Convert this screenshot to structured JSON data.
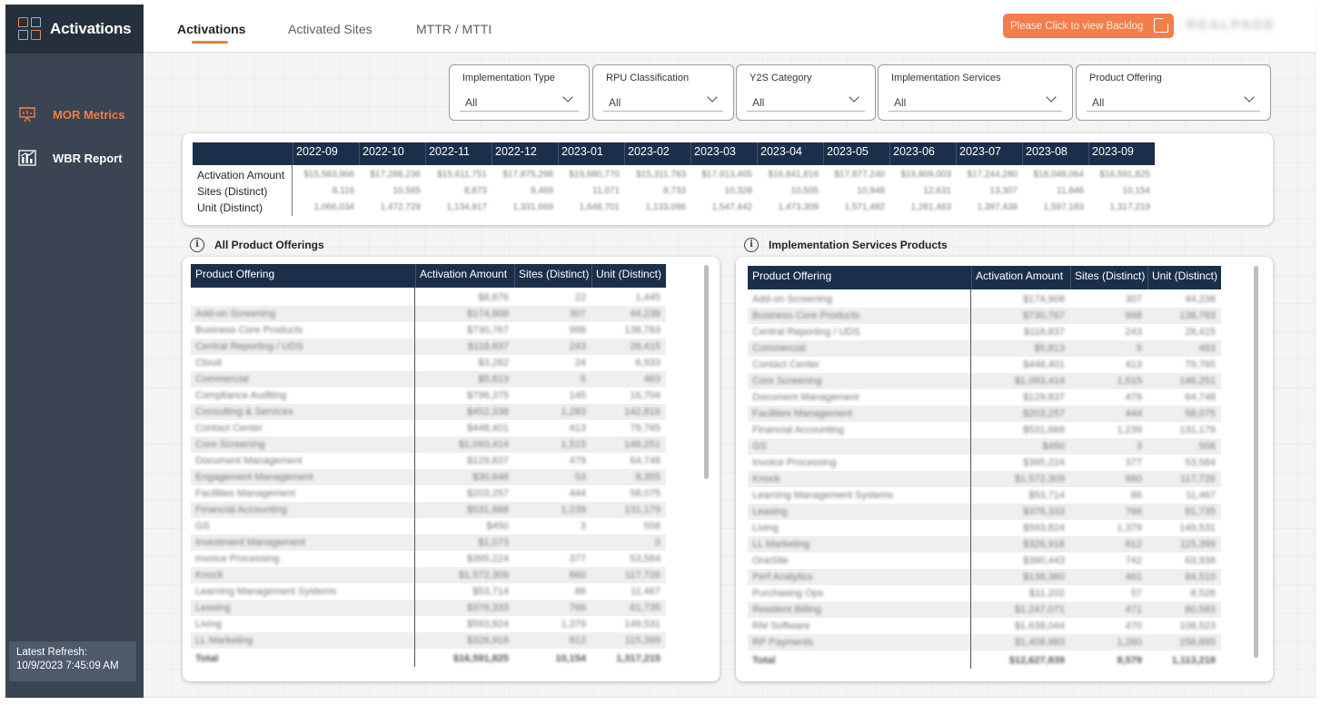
{
  "app": {
    "title": "Activations"
  },
  "sidebar": {
    "items": [
      {
        "label": "MOR Metrics",
        "icon": "presentation-chart-icon",
        "active": true
      },
      {
        "label": "WBR Report",
        "icon": "bar-chart-icon",
        "active": false
      }
    ],
    "refresh": {
      "label": "Latest Refresh:",
      "value": "10/9/2023 7:45:09 AM"
    }
  },
  "tabs": [
    {
      "label": "Activations",
      "active": true
    },
    {
      "label": "Activated Sites",
      "active": false
    },
    {
      "label": "MTTR / MTTI",
      "active": false
    }
  ],
  "header": {
    "backlog_button": "Please Click to view Backlog",
    "logo_text": "REALPAGE"
  },
  "filters": [
    {
      "label": "Implementation Type",
      "value": "All"
    },
    {
      "label": "RPU Classification",
      "value": "All"
    },
    {
      "label": "Y2S Category",
      "value": "All"
    },
    {
      "label": "Implementation Services",
      "value": "All"
    },
    {
      "label": "Product Offering",
      "value": "All"
    }
  ],
  "monthly": {
    "months": [
      "2022-09",
      "2022-10",
      "2022-11",
      "2022-12",
      "2023-01",
      "2023-02",
      "2023-03",
      "2023-04",
      "2023-05",
      "2023-06",
      "2023-07",
      "2023-08",
      "2023-09"
    ],
    "rows": [
      {
        "label": "Activation Amount",
        "values": [
          "$15,583,966",
          "$17,288,236",
          "$15,611,751",
          "$17,875,298",
          "$19,680,770",
          "$15,311,783",
          "$17,913,405",
          "$16,841,816",
          "$17,877,240",
          "$19,809,003",
          "$17,244,280",
          "$18,048,064",
          "$16,591,825"
        ]
      },
      {
        "label": "Sites (Distinct)",
        "values": [
          "8,116",
          "10,565",
          "8,873",
          "9,469",
          "11,071",
          "8,733",
          "10,328",
          "10,505",
          "10,948",
          "12,631",
          "13,307",
          "11,846",
          "10,154"
        ]
      },
      {
        "label": "Unit (Distinct)",
        "values": [
          "1,066,034",
          "1,472,729",
          "1,134,917",
          "1,331,669",
          "1,648,701",
          "1,133,096",
          "1,547,442",
          "1,473,309",
          "1,571,482",
          "1,281,463",
          "1,397,438",
          "1,597,183",
          "1,317,219"
        ]
      }
    ]
  },
  "all_products": {
    "title": "All Product Offerings",
    "columns": [
      "Product Offering",
      "Activation Amount",
      "Sites (Distinct)",
      "Unit (Distinct)"
    ],
    "rows": [
      [
        "",
        "$8,876",
        "22",
        "1,445"
      ],
      [
        "Add-on Screening",
        "$174,908",
        "307",
        "44,238"
      ],
      [
        "Business Core Products",
        "$730,767",
        "998",
        "138,783"
      ],
      [
        "Central Reporting / UDS",
        "$118,837",
        "243",
        "28,415"
      ],
      [
        "Cloud",
        "$3,282",
        "24",
        "6,933"
      ],
      [
        "Commercial",
        "$5,813",
        "5",
        "463"
      ],
      [
        "Compliance Auditing",
        "$796,375",
        "145",
        "16,704"
      ],
      [
        "Consulting & Services",
        "$452,338",
        "1,283",
        "142,816"
      ],
      [
        "Contact Center",
        "$448,401",
        "413",
        "79,765"
      ],
      [
        "Core Screening",
        "$1,093,414",
        "1,515",
        "146,251"
      ],
      [
        "Document Management",
        "$129,837",
        "479",
        "64,748"
      ],
      [
        "Engagement Management",
        "$30,648",
        "53",
        "8,355"
      ],
      [
        "Facilities Management",
        "$203,257",
        "444",
        "58,075"
      ],
      [
        "Financial Accounting",
        "$531,668",
        "1,239",
        "131,179"
      ],
      [
        "GS",
        "$450",
        "3",
        "556"
      ],
      [
        "Investment Management",
        "$1,073",
        "",
        "0"
      ],
      [
        "Invoice Processing",
        "$395,224",
        "377",
        "53,584"
      ],
      [
        "Knock",
        "$1,572,309",
        "660",
        "117,726"
      ],
      [
        "Learning Management Systems",
        "$53,714",
        "86",
        "11,467"
      ],
      [
        "Leasing",
        "$376,333",
        "766",
        "81,735"
      ],
      [
        "Living",
        "$593,824",
        "1,379",
        "149,531"
      ],
      [
        "LL Marketing",
        "$326,918",
        "812",
        "115,399"
      ]
    ],
    "total": [
      "Total",
      "$16,591,825",
      "10,154",
      "1,317,215"
    ]
  },
  "impl_products": {
    "title": "Implementation Services Products",
    "columns": [
      "Product Offering",
      "Activation Amount",
      "Sites (Distinct)",
      "Unit (Distinct)"
    ],
    "rows": [
      [
        "Add-on Screening",
        "$174,908",
        "307",
        "44,238"
      ],
      [
        "Business Core Products",
        "$730,767",
        "998",
        "138,783"
      ],
      [
        "Central Reporting / UDS",
        "$118,837",
        "243",
        "28,415"
      ],
      [
        "Commercial",
        "$5,813",
        "5",
        "463"
      ],
      [
        "Contact Center",
        "$448,401",
        "413",
        "79,765"
      ],
      [
        "Core Screening",
        "$1,093,414",
        "1,515",
        "146,251"
      ],
      [
        "Document Management",
        "$129,837",
        "479",
        "64,748"
      ],
      [
        "Facilities Management",
        "$203,257",
        "444",
        "58,075"
      ],
      [
        "Financial Accounting",
        "$531,668",
        "1,239",
        "131,179"
      ],
      [
        "GS",
        "$450",
        "3",
        "556"
      ],
      [
        "Invoice Processing",
        "$395,224",
        "377",
        "53,584"
      ],
      [
        "Knock",
        "$1,572,309",
        "660",
        "117,726"
      ],
      [
        "Learning Management Systems",
        "$53,714",
        "86",
        "11,467"
      ],
      [
        "Leasing",
        "$376,333",
        "766",
        "81,735"
      ],
      [
        "Living",
        "$593,824",
        "1,379",
        "149,531"
      ],
      [
        "LL Marketing",
        "$326,918",
        "812",
        "115,399"
      ],
      [
        "OneSite",
        "$390,443",
        "742",
        "63,938"
      ],
      [
        "Perf Analytics",
        "$138,360",
        "461",
        "84,510"
      ],
      [
        "Purchasing Ops",
        "$11,202",
        "57",
        "8,526"
      ],
      [
        "Resident Billing",
        "$1,247,071",
        "471",
        "80,583"
      ],
      [
        "RM Software",
        "$1,638,044",
        "470",
        "108,523"
      ],
      [
        "RP Payments",
        "$1,408,983",
        "1,260",
        "156,895"
      ]
    ],
    "total": [
      "Total",
      "$12,627,839",
      "8,579",
      "1,113,218"
    ]
  },
  "colors": {
    "accent": "#f07e3f",
    "header_navy": "#1c2f4a",
    "sidebar": "#3a4452"
  }
}
